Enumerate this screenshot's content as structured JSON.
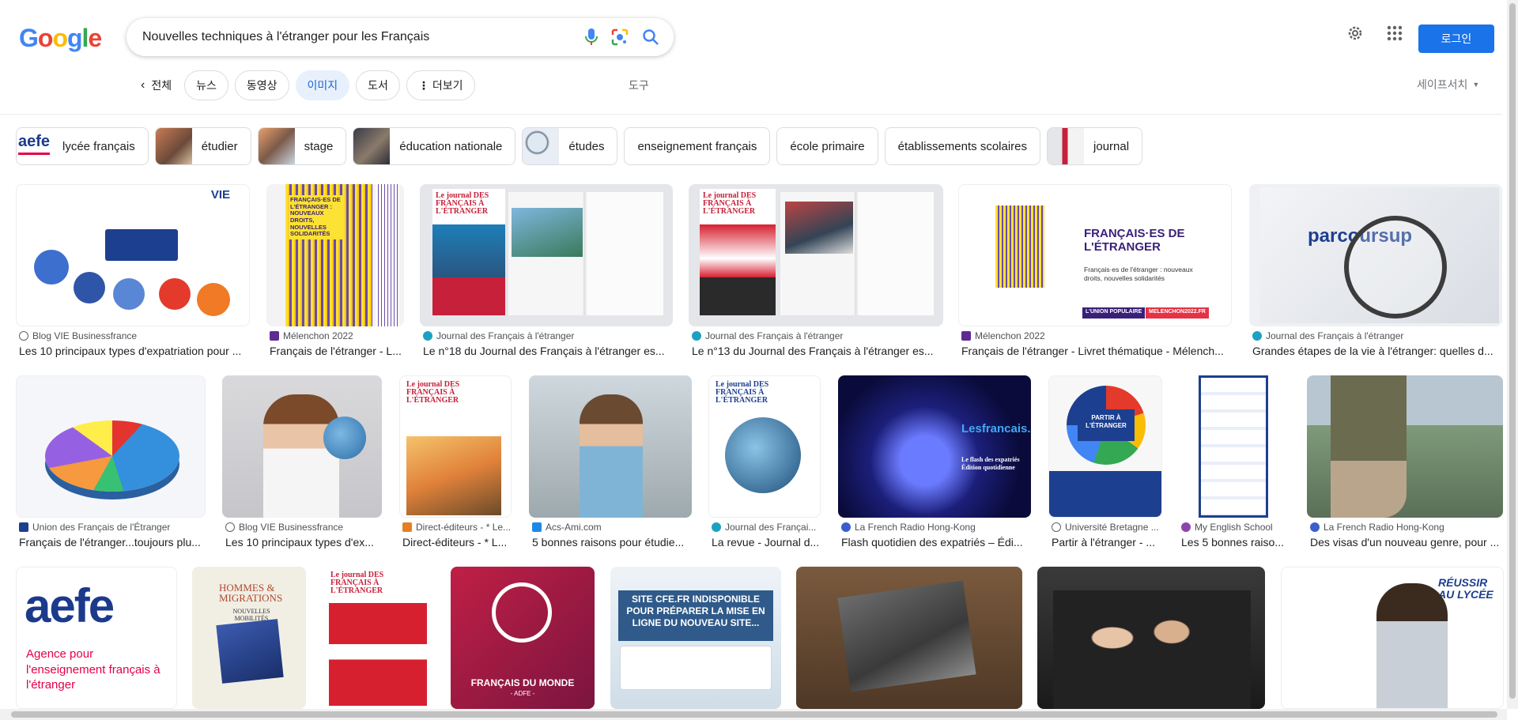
{
  "logo": {
    "letters": [
      "G",
      "o",
      "o",
      "g",
      "l",
      "e"
    ],
    "colors": [
      "#4285f4",
      "#ea4335",
      "#fbbc05",
      "#4285f4",
      "#34a853",
      "#ea4335"
    ]
  },
  "search": {
    "query": "Nouvelles techniques à l'étranger pour les Français"
  },
  "header": {
    "login_label": "로그인",
    "settings_icon": "gear-icon",
    "apps_icon": "apps-grid-icon"
  },
  "tabs": {
    "all_label": "전체",
    "items": [
      {
        "label": "뉴스"
      },
      {
        "label": "동영상"
      },
      {
        "label": "이미지"
      },
      {
        "label": "도서"
      },
      {
        "label": "더보기"
      }
    ],
    "tools_label": "도구",
    "safesearch_label": "세이프서치"
  },
  "chips": [
    {
      "label": "lycée français"
    },
    {
      "label": "étudier"
    },
    {
      "label": "stage"
    },
    {
      "label": "éducation nationale"
    },
    {
      "label": "études"
    },
    {
      "label": "enseignement français"
    },
    {
      "label": "école primaire"
    },
    {
      "label": "établissements scolaires"
    },
    {
      "label": "journal"
    }
  ],
  "results": [
    {
      "source": "Blog VIE Businessfrance",
      "title": "Les 10 principaux types d'expatriation pour ..."
    },
    {
      "source": "Mélenchon 2022",
      "title": "Français de l'étranger - L..."
    },
    {
      "source": "Journal des Français à l'étranger",
      "title": "Le n°18 du Journal des Français à l'étranger es..."
    },
    {
      "source": "Journal des Français à l'étranger",
      "title": "Le n°13 du Journal des Français à l'étranger es..."
    },
    {
      "source": "Mélenchon 2022",
      "title": "Français de l'étranger - Livret thématique - Mélench..."
    },
    {
      "source": "Journal des Français à l'étranger",
      "title": "Grandes étapes de la vie à l'étranger: quelles d..."
    },
    {
      "source": "Union des Français de l'Étranger",
      "title": "Français de l'étranger...toujours plu..."
    },
    {
      "source": "Blog VIE Businessfrance",
      "title": "Les 10 principaux types d'ex..."
    },
    {
      "source": "Direct-éditeurs - * Le...",
      "title": "Direct-éditeurs - * L..."
    },
    {
      "source": "Acs-Ami.com",
      "title": "5 bonnes raisons pour étudie..."
    },
    {
      "source": "Journal des Françai...",
      "title": "La revue - Journal d..."
    },
    {
      "source": "La French Radio Hong-Kong",
      "title": "Flash quotidien des expatriés – Édi..."
    },
    {
      "source": "Université Bretagne ...",
      "title": "Partir à l'étranger - ..."
    },
    {
      "source": "My English School",
      "title": "Les 5 bonnes raiso..."
    },
    {
      "source": "La French Radio Hong-Kong",
      "title": "Des visas d'un nouveau genre, pour ..."
    }
  ],
  "image_text": {
    "aefe_chip": "aefe",
    "vie_logo": "VIE",
    "melenchon_cover": "FRANÇAIS·ES DE L'ÉTRANGER : NOUVEAUX DROITS, NOUVELLES SOLIDARITÉS",
    "journal_masthead": "Le journal DES FRANÇAIS À L'ÉTRANGER",
    "melenchon_banner_title": "FRANÇAIS·ES DE L'ÉTRANGER",
    "melenchon_banner_sub": "Français·es de l'étranger : nouveaux droits, nouvelles solidarités",
    "union_populaire": "L'UNION POPULAIRE",
    "melenchon_url": "MELENCHON2022.FR",
    "parcoursup": "parcoursup",
    "lesfrancais_press": "Lesfrancais.press",
    "flash_text": "Le flash des expatriés Édition quotidienne",
    "partir_etranger": "PARTIR À L'ÉTRANGER",
    "aefe_big": "aefe",
    "aefe_tagline": "Agence pour l'enseignement français à l'étranger",
    "hommes_migrations": "HOMMES & MIGRATIONS",
    "nouvelles_mobilites": "NOUVELLES MOBILITÉS",
    "francais_du_monde": "FRANÇAIS DU MONDE",
    "adfe": "- ADFE -",
    "cfe_notice": "SITE CFE.FR INDISPONIBLE POUR PRÉPARER LA MISE EN LIGNE DU NOUVEAU SITE...",
    "reussir_lycee": "RÉUSSIR AU LYCÉE"
  },
  "colors": {
    "accent": "#1a73e8",
    "active_tab_bg": "#e8f0fe",
    "active_tab_text": "#1967d2"
  }
}
